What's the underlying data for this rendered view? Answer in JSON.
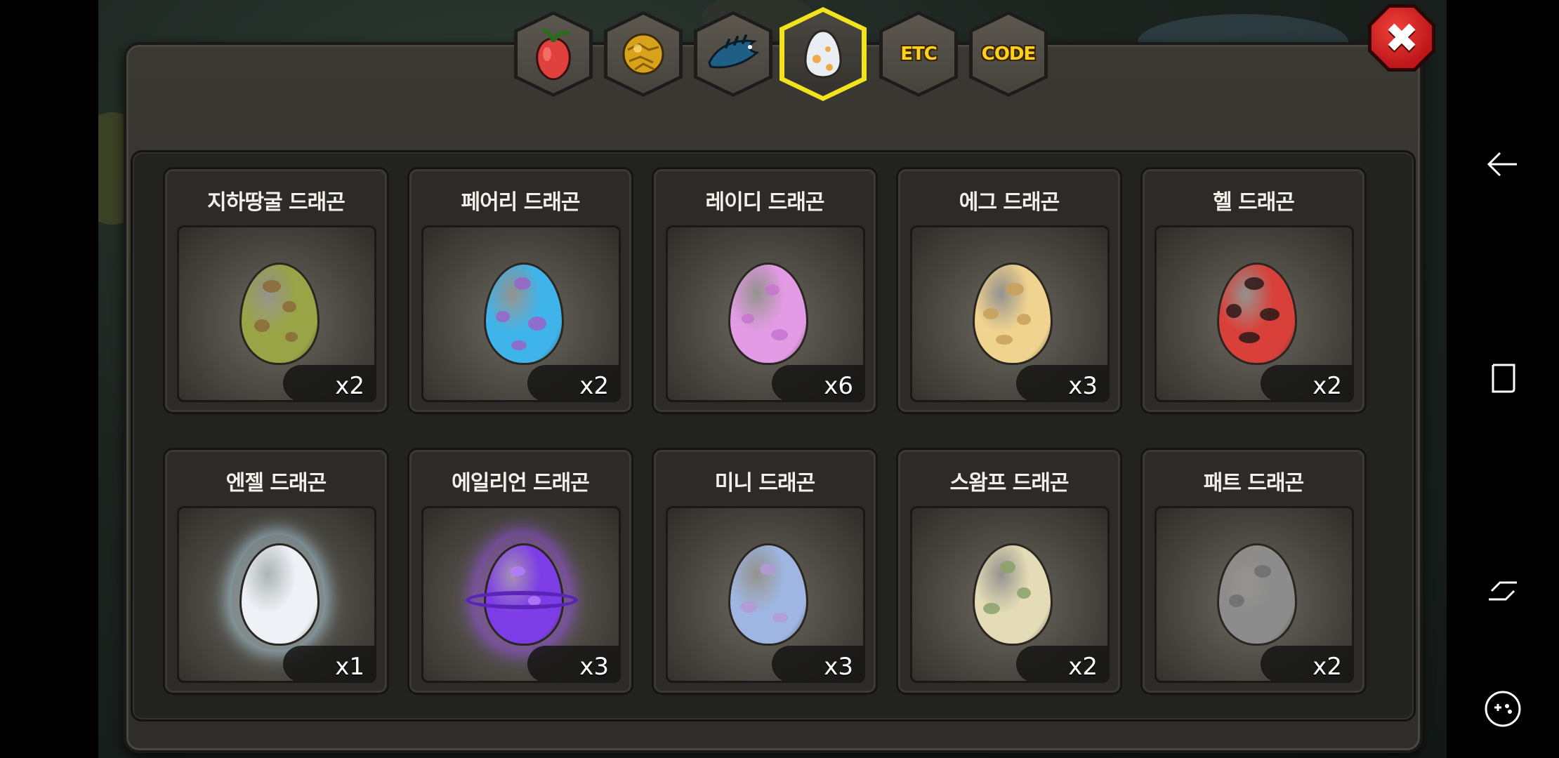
{
  "tabs": [
    {
      "name": "fruit",
      "icon": "fruit-icon"
    },
    {
      "name": "gold",
      "icon": "gold-icon"
    },
    {
      "name": "dragon",
      "icon": "dragon-icon"
    },
    {
      "name": "egg",
      "icon": "egg-icon",
      "active": true
    },
    {
      "name": "etc",
      "label": "ETC"
    },
    {
      "name": "code",
      "label": "CODE"
    }
  ],
  "close_label": "✖",
  "eggs": [
    {
      "title": "지하땅굴 드래곤",
      "count": "x2",
      "color": "#98a445",
      "spot": "#8a6a3a"
    },
    {
      "title": "페어리 드래곤",
      "count": "x2",
      "color": "#3fb4ea",
      "spot": "#9a63c8"
    },
    {
      "title": "레이디 드래곤",
      "count": "x6",
      "color": "#e49be6",
      "spot": "#c774cf"
    },
    {
      "title": "에그 드래곤",
      "count": "x3",
      "color": "#f0d38e",
      "spot": "#c8a15a"
    },
    {
      "title": "헬 드래곤",
      "count": "x2",
      "color": "#d9403a",
      "spot": "#2a1a18"
    },
    {
      "title": "엔젤 드래곤",
      "count": "x1",
      "color": "#eef1f6",
      "spot": "#c9d2dc"
    },
    {
      "title": "에일리언 드래곤",
      "count": "x3",
      "color": "#7d3de6",
      "spot": "#b47bff"
    },
    {
      "title": "미니 드래곤",
      "count": "x3",
      "color": "#9fb6e2",
      "spot": "#b49ad8"
    },
    {
      "title": "스왐프 드래곤",
      "count": "x2",
      "color": "#e4dcb6",
      "spot": "#8aa26a"
    },
    {
      "title": "패트 드래곤",
      "count": "x2",
      "color": "#8c8c8c",
      "spot": "#6e6e6e"
    }
  ],
  "system_nav": [
    "back-icon",
    "recents-icon",
    "home-icon",
    "game-launcher-icon"
  ]
}
